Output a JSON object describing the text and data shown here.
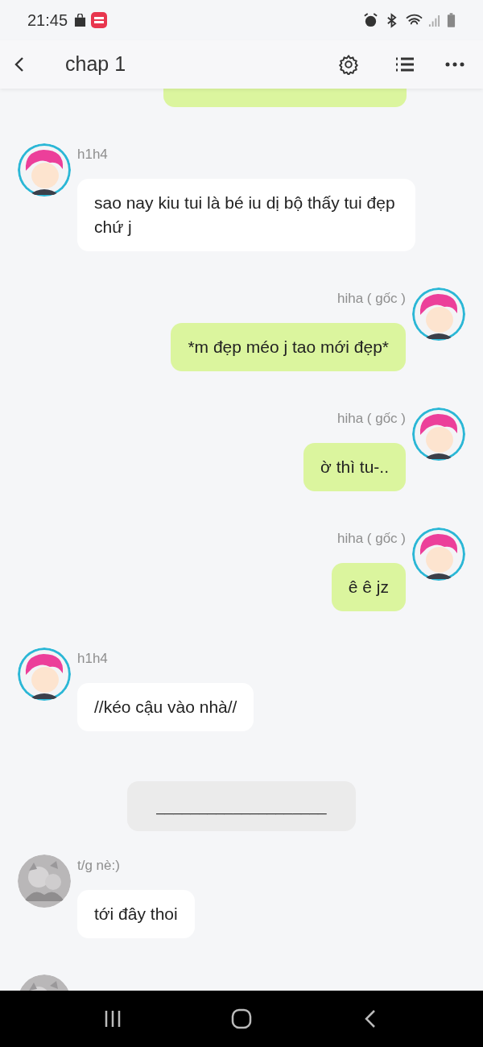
{
  "status_bar": {
    "time": "21:45"
  },
  "header": {
    "title": "chap 1"
  },
  "messages": [
    {
      "kind": "partial",
      "mine": true
    },
    {
      "kind": "message",
      "mine": false,
      "avatar": {
        "kind": "cartoon"
      },
      "name": "h1h4",
      "text": "sao nay kiu tui là bé iu dị bộ thấy tui đẹp chứ j"
    },
    {
      "kind": "message",
      "mine": true,
      "avatar": {
        "kind": "cartoon"
      },
      "name": "hiha ( gốc )",
      "text": "*m đẹp méo j tao mới đẹp*"
    },
    {
      "kind": "message",
      "mine": true,
      "avatar": {
        "kind": "cartoon"
      },
      "name": "hiha ( gốc )",
      "text": "ờ thì tu-.."
    },
    {
      "kind": "message",
      "mine": true,
      "avatar": {
        "kind": "cartoon"
      },
      "name": "hiha ( gốc )",
      "text": "ê ê jz"
    },
    {
      "kind": "message",
      "mine": false,
      "avatar": {
        "kind": "cartoon"
      },
      "name": "h1h4",
      "text": "//kéo cậu vào nhà//"
    },
    {
      "kind": "divider",
      "text": "____________________"
    },
    {
      "kind": "message",
      "mine": false,
      "avatar": {
        "kind": "sketch"
      },
      "name": "t/g nè:)",
      "text": "tới đây thoi"
    },
    {
      "kind": "cut",
      "mine": false,
      "avatar": {
        "kind": "sketch"
      }
    }
  ]
}
